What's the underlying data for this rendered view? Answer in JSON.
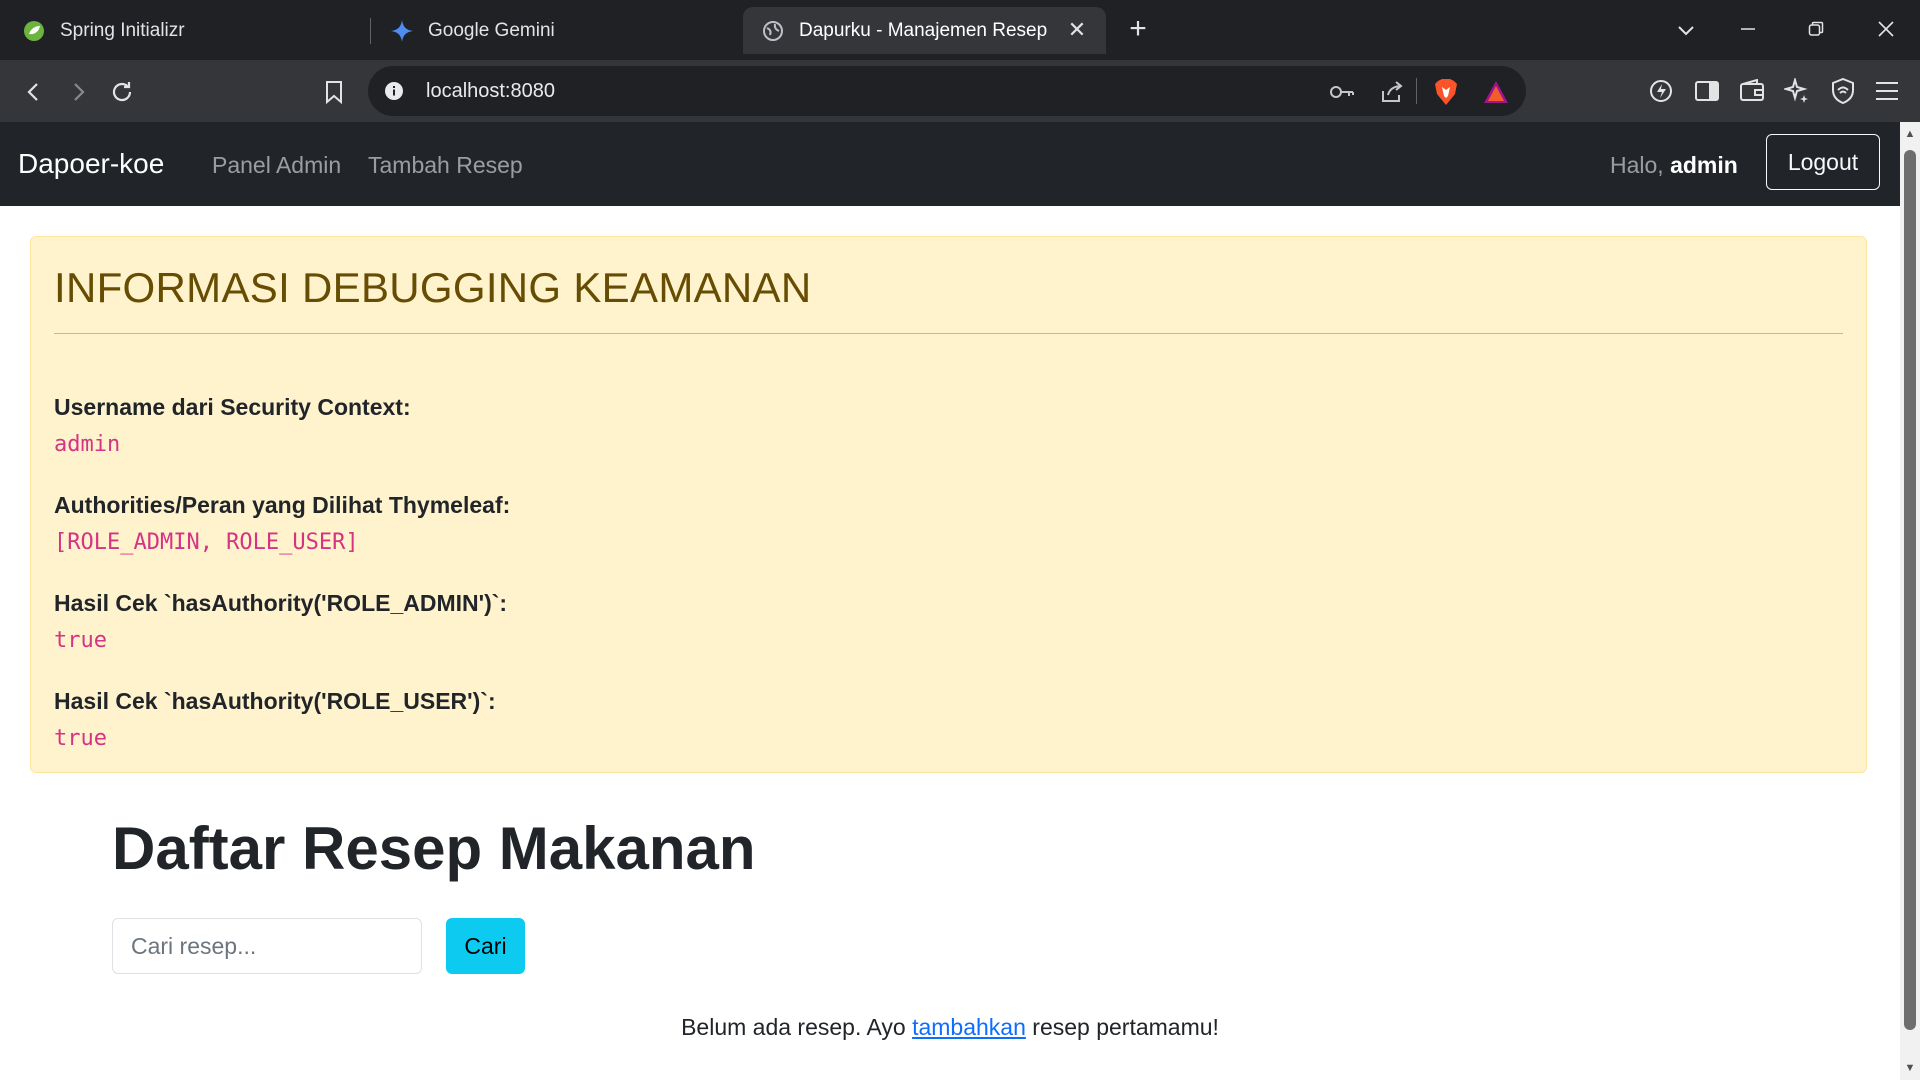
{
  "browser": {
    "tabs": [
      {
        "title": "Spring Initializr"
      },
      {
        "title": "Google Gemini"
      },
      {
        "title": "Dapurku - Manajemen Resep"
      }
    ],
    "address": "localhost:8080",
    "colors": {
      "tabbar": "#202124",
      "toolbar": "#35363a",
      "active_tab": "#35363a"
    }
  },
  "navbar": {
    "brand": "Dapoer-koe",
    "links": [
      "Panel Admin",
      "Tambah Resep"
    ],
    "greeting_prefix": "Halo, ",
    "username": "admin",
    "logout_label": "Logout"
  },
  "debug": {
    "title": "INFORMASI DEBUGGING KEAMANAN",
    "items": [
      {
        "label": "Username dari Security Context:",
        "value": "admin"
      },
      {
        "label": "Authorities/Peran yang Dilihat Thymeleaf:",
        "value": "[ROLE_ADMIN, ROLE_USER]"
      },
      {
        "label": "Hasil Cek `hasAuthority('ROLE_ADMIN')`:",
        "value": "true"
      },
      {
        "label": "Hasil Cek `hasAuthority('ROLE_USER')`:",
        "value": "true"
      }
    ]
  },
  "main": {
    "title": "Daftar Resep Makanan",
    "search_placeholder": "Cari resep...",
    "search_value": "",
    "search_button": "Cari",
    "empty_before": "Belum ada resep. Ayo ",
    "empty_link": "tambahkan",
    "empty_after": " resep pertamamu!"
  },
  "colors": {
    "navbar": "#212529",
    "alert_bg": "#fff3cd",
    "alert_text": "#664d03",
    "code": "#d63384",
    "search_btn": "#0dcaf0",
    "link": "#0d6efd"
  }
}
